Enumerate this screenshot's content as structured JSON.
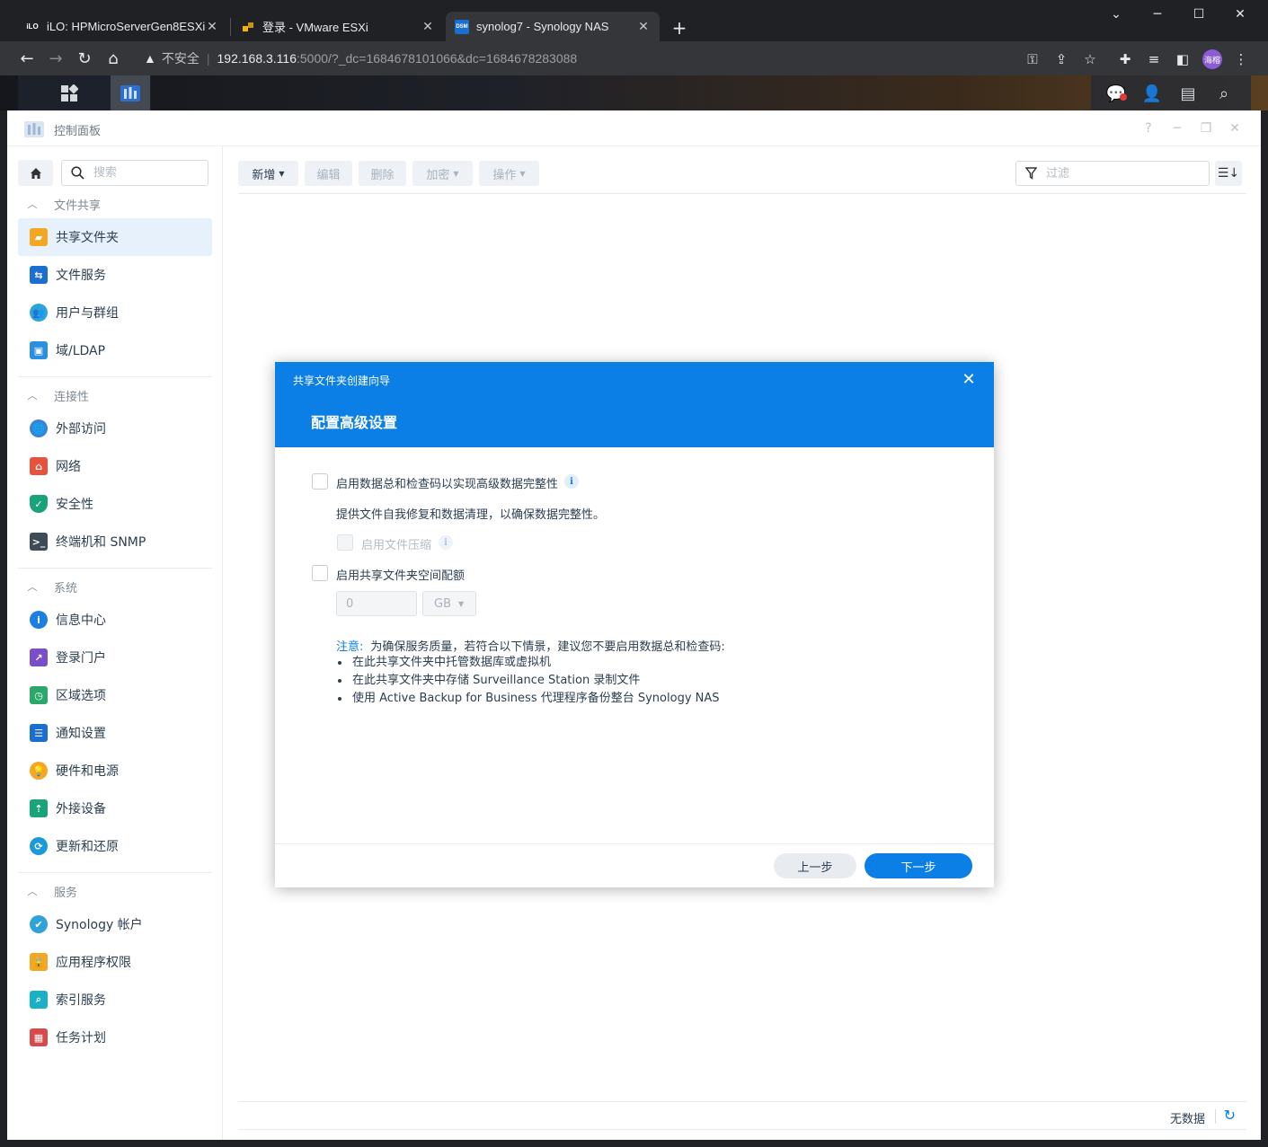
{
  "browser": {
    "tabs": [
      {
        "title": "iLO: HPMicroServerGen8ESXi",
        "favicon": "iLO"
      },
      {
        "title": "登录 - VMware ESXi",
        "favicon": "vm"
      },
      {
        "title": "synolog7 - Synology NAS",
        "favicon": "DSM"
      }
    ],
    "security_label": "不安全",
    "url_host": "192.168.3.116",
    "url_rest": ":5000/?_dc=1684678101066&dc=1684678283088",
    "profile_initials": "海榕"
  },
  "window": {
    "title": "控制面板"
  },
  "sidebar": {
    "search_placeholder": "搜索",
    "sections": [
      {
        "label": "文件共享",
        "items": [
          {
            "label": "共享文件夹",
            "color": "#f5a623"
          },
          {
            "label": "文件服务",
            "color": "#1a6fd0"
          },
          {
            "label": "用户与群组",
            "color": "#2ea3d8"
          },
          {
            "label": "域/LDAP",
            "color": "#2a8fe0"
          }
        ]
      },
      {
        "label": "连接性",
        "items": [
          {
            "label": "外部访问",
            "color": "#3a84d8"
          },
          {
            "label": "网络",
            "color": "#e8523c"
          },
          {
            "label": "安全性",
            "color": "#1aa37a"
          },
          {
            "label": "终端机和 SNMP",
            "color": "#3d4a58"
          }
        ]
      },
      {
        "label": "系统",
        "items": [
          {
            "label": "信息中心",
            "color": "#1a7fe0"
          },
          {
            "label": "登录门户",
            "color": "#7b4ec9"
          },
          {
            "label": "区域选项",
            "color": "#2aa86a"
          },
          {
            "label": "通知设置",
            "color": "#1a6fd0"
          },
          {
            "label": "硬件和电源",
            "color": "#f5a623"
          },
          {
            "label": "外接设备",
            "color": "#1aa37a"
          },
          {
            "label": "更新和还原",
            "color": "#1a9ad8"
          }
        ]
      },
      {
        "label": "服务",
        "items": [
          {
            "label": "Synology 帐户",
            "color": "#2ea3d8"
          },
          {
            "label": "应用程序权限",
            "color": "#f5a623"
          },
          {
            "label": "索引服务",
            "color": "#1ab0c8"
          },
          {
            "label": "任务计划",
            "color": "#d84a4a"
          }
        ]
      }
    ]
  },
  "toolbar": {
    "create": "新增",
    "edit": "编辑",
    "delete": "删除",
    "encrypt": "加密",
    "action": "操作",
    "filter_placeholder": "过滤"
  },
  "footer": {
    "status": "无数据"
  },
  "dialog": {
    "subtitle": "共享文件夹创建向导",
    "title": "配置高级设置",
    "checksum_label": "启用数据总和检查码以实现高级数据完整性",
    "checksum_desc": "提供文件自我修复和数据清理，以确保数据完整性。",
    "compression_label": "启用文件压缩",
    "quota_label": "启用共享文件夹空间配额",
    "quota_value": "0",
    "quota_unit": "GB",
    "note_key": "注意:",
    "note_text": "为确保服务质量，若符合以下情景，建议您不要启用数据总和检查码:",
    "note_items": [
      "在此共享文件夹中托管数据库或虚拟机",
      "在此共享文件夹中存储 Surveillance Station 录制文件",
      "使用 Active Backup for Business 代理程序备份整台 Synology NAS"
    ],
    "prev_button": "上一步",
    "next_button": "下一步",
    "checksum_checked": false,
    "compression_checked": false,
    "quota_checked": false
  },
  "colors": {
    "accent": "#0b7fe6",
    "selected_bg": "#e6f1fc"
  }
}
